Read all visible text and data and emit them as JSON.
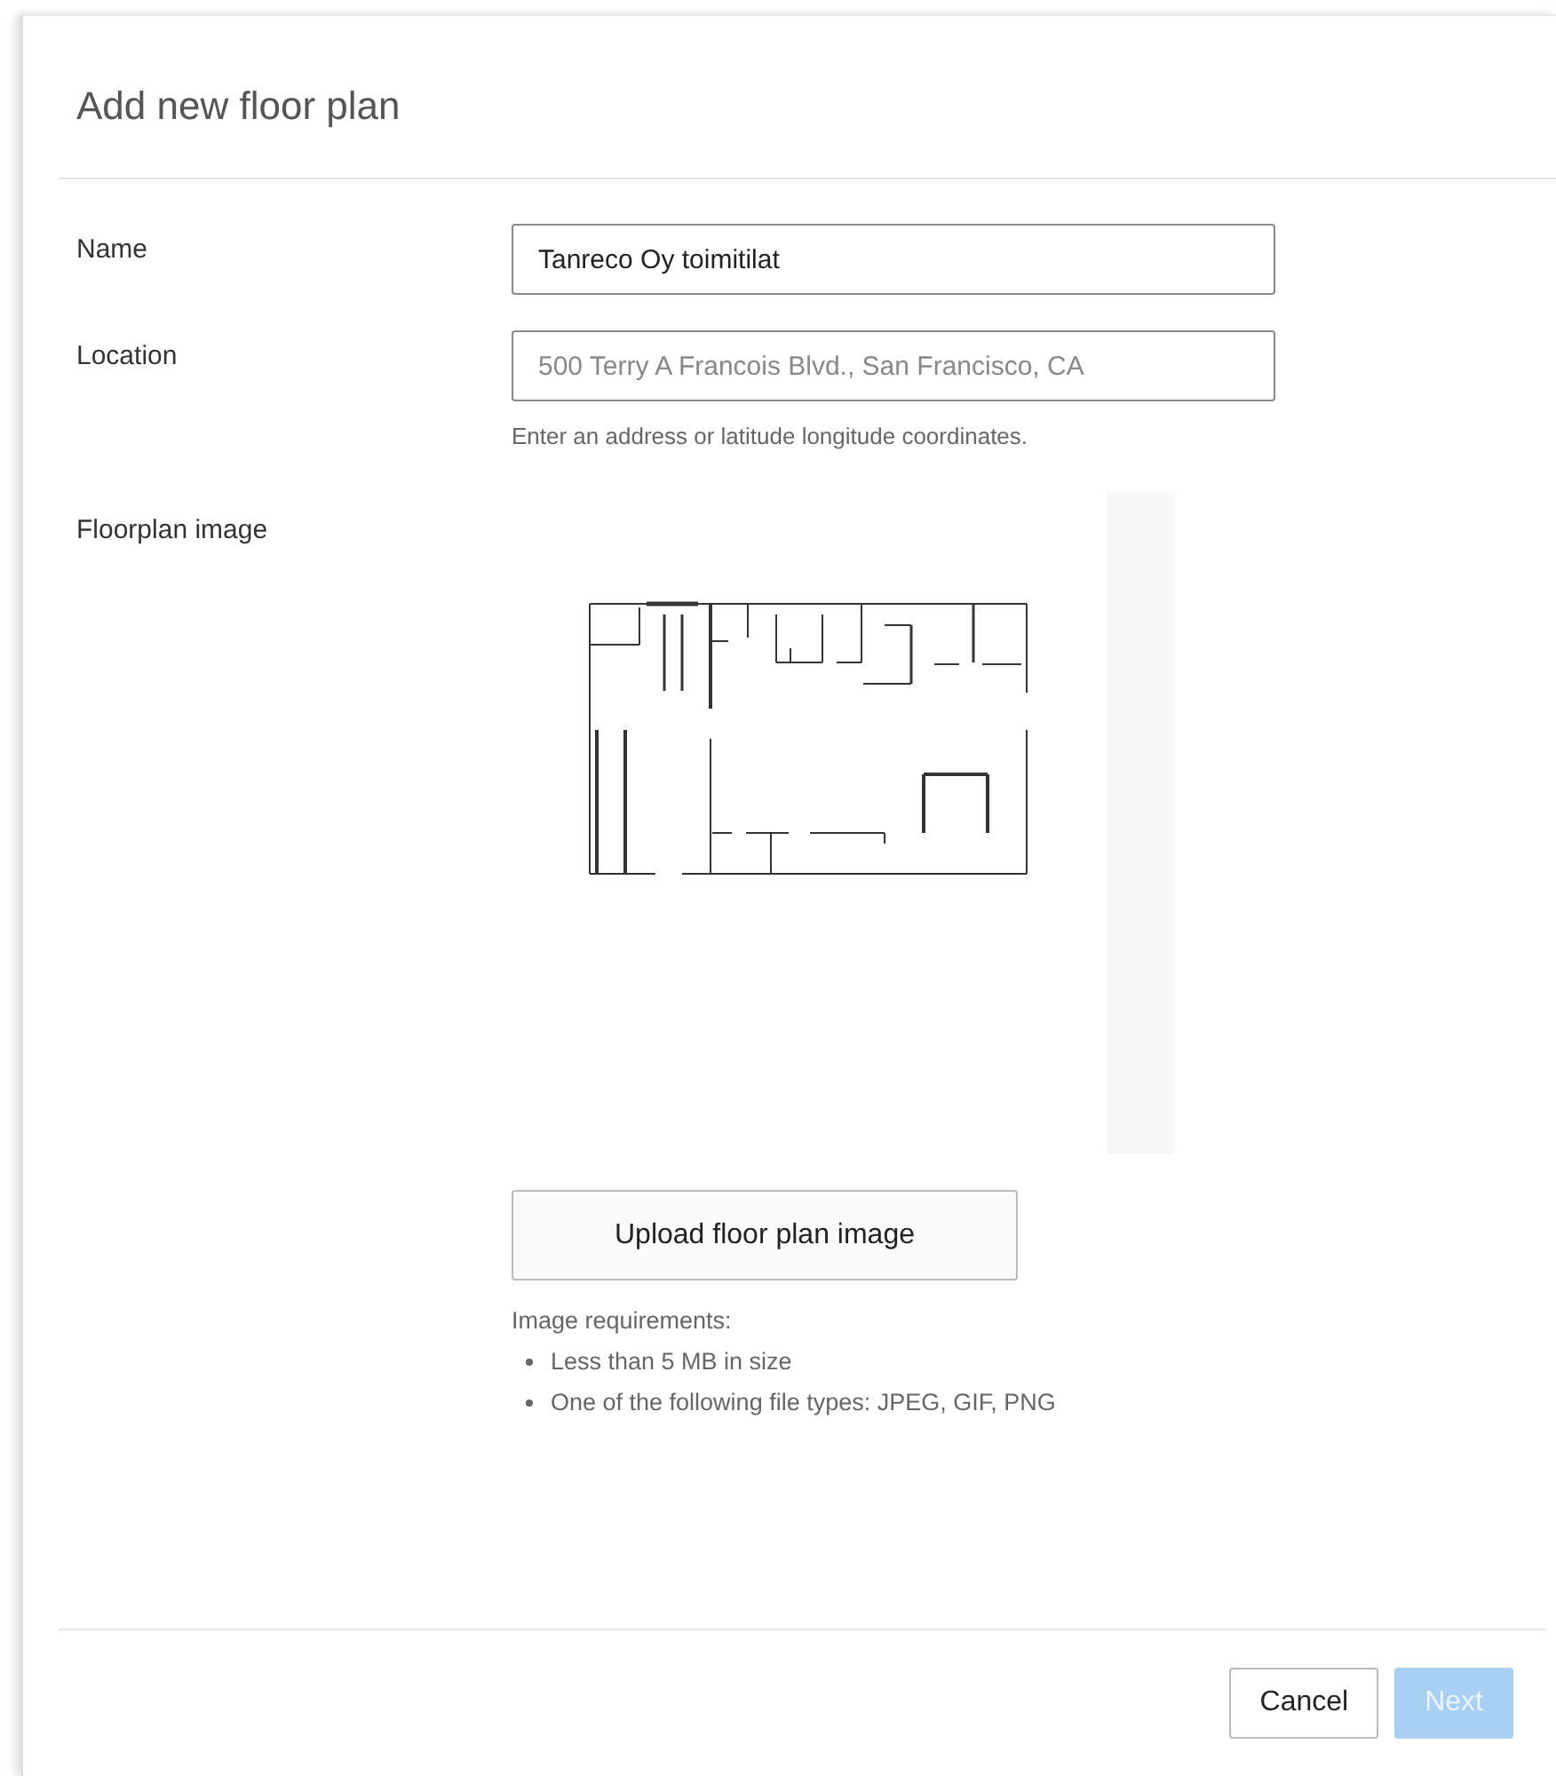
{
  "dialog": {
    "title": "Add new floor plan"
  },
  "fields": [
    {
      "label": "Name",
      "value": "Tanreco Oy toimitilat"
    },
    {
      "label": "Location",
      "placeholder": "500 Terry A Francois Blvd., San Francisco, CA",
      "help": "Enter an address or latitude longitude coordinates."
    }
  ],
  "floorplan": {
    "label": "Floorplan image",
    "upload_button": "Upload floor plan image",
    "requirements_title": "Image requirements:",
    "requirements": [
      "Less than 5 MB in size",
      "One of the following file types: JPEG, GIF, PNG"
    ]
  },
  "buttons": [
    {
      "label": "Cancel",
      "kind": "secondary",
      "disabled": false
    },
    {
      "label": "Next",
      "kind": "primary",
      "disabled": true
    }
  ]
}
